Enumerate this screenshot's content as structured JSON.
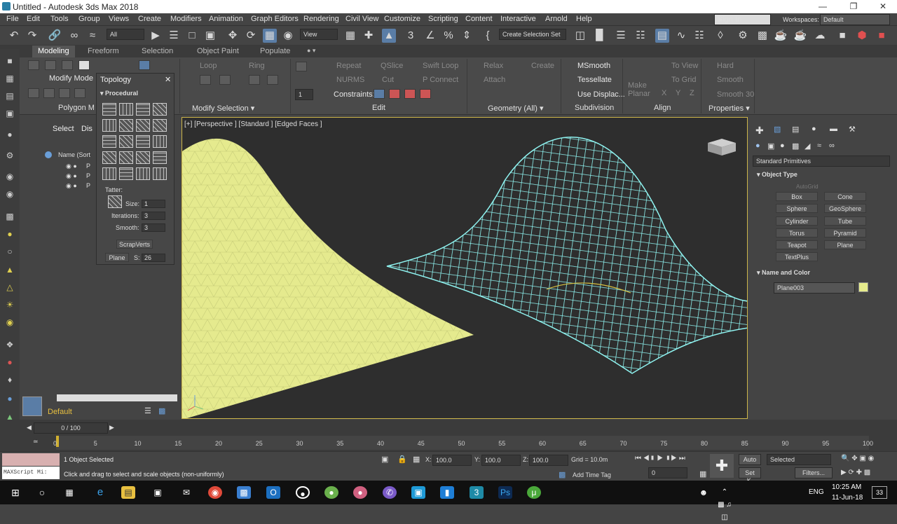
{
  "title": "Untitled - Autodesk 3ds Max 2018",
  "menu": [
    "File",
    "Edit",
    "Tools",
    "Group",
    "Views",
    "Create",
    "Modifiers",
    "Animation",
    "Graph Editors",
    "Rendering",
    "Civil View",
    "Customize",
    "Scripting",
    "Content",
    "Interactive",
    "Arnold",
    "Help"
  ],
  "signin": "Sign In",
  "workspaces_label": "Workspaces:",
  "workspace": "Default",
  "toolbar": {
    "filter": "All",
    "view": "View",
    "selset": "Create Selection Set"
  },
  "ribbon_tabs": [
    "Modeling",
    "Freeform",
    "Selection",
    "Object Paint",
    "Populate"
  ],
  "ribbon": {
    "modify_mode": "Modify Mode",
    "polygon_m": "Polygon M",
    "loop": "Loop",
    "ring": "Ring",
    "modify_selection": "Modify Selection",
    "repeat": "Repeat",
    "qslice": "QSlice",
    "swift_loop": "Swift Loop",
    "nurms": "NURMS",
    "cut": "Cut",
    "p_connect": "P Connect",
    "constraints": "Constraints:",
    "edit": "Edit",
    "relax": "Relax",
    "create": "Create",
    "attach": "Attach",
    "geometry_all": "Geometry (All)",
    "msmooth": "MSmooth",
    "tessellate": "Tessellate",
    "use_displace": "Use Displac...",
    "subdivision": "Subdivision",
    "make_planar": "Make Planar",
    "to_view": "To View",
    "to_grid": "To Grid",
    "x": "X",
    "y": "Y",
    "z": "Z",
    "align": "Align",
    "hard": "Hard",
    "smooth": "Smooth",
    "smooth30": "Smooth 30",
    "properties": "Properties",
    "spin_value": "1"
  },
  "topology": {
    "title": "Topology",
    "procedural": "Procedural",
    "tatter": "Tatter:",
    "size_label": "Size:",
    "size": "1",
    "iter_label": "Iterations:",
    "iter": "3",
    "smooth_label": "Smooth:",
    "smooth": "3",
    "scrapverts": "ScrapVerts",
    "plane": "Plane",
    "s_label": "S:",
    "s": "26"
  },
  "scene": {
    "select": "Select",
    "dis": "Dis",
    "name_col": "Name (Sort",
    "layer": "Default",
    "rows": [
      "P",
      "P",
      "P"
    ]
  },
  "viewport": {
    "label": "[+] [Perspective ] [Standard ] [Edged Faces ]"
  },
  "cmd": {
    "category": "Standard Primitives",
    "object_type": "Object Type",
    "autogrid": "AutoGrid",
    "buttons": [
      "Box",
      "Cone",
      "Sphere",
      "GeoSphere",
      "Cylinder",
      "Tube",
      "Torus",
      "Pyramid",
      "Teapot",
      "Plane",
      "TextPlus"
    ],
    "name_color": "Name and Color",
    "obj_name": "Plane003",
    "obj_color": "#e6ec8c"
  },
  "timeline": {
    "frame": "0 / 100",
    "ticks": [
      "0",
      "5",
      "10",
      "15",
      "20",
      "25",
      "30",
      "35",
      "40",
      "45",
      "50",
      "55",
      "60",
      "65",
      "70",
      "75",
      "80",
      "85",
      "90",
      "95",
      "100"
    ]
  },
  "status": {
    "maxscript": "MAXScript Mi:",
    "selected": "1 Object Selected",
    "prompt": "Click and drag to select and scale objects (non-uniformly)",
    "x_label": "X:",
    "x": "100.0",
    "y_label": "Y:",
    "y": "100.0",
    "z_label": "Z:",
    "z": "100.0",
    "grid": "Grid = 10.0m",
    "add_time_tag": "Add Time Tag",
    "auto": "Auto",
    "setk": "Set K.",
    "sel": "Selected",
    "filters": "Filters...",
    "frame": "0"
  },
  "taskbar": {
    "time": "10:25 AM",
    "date": "11-Jun-18",
    "lang": "ENG",
    "notif": "33"
  }
}
